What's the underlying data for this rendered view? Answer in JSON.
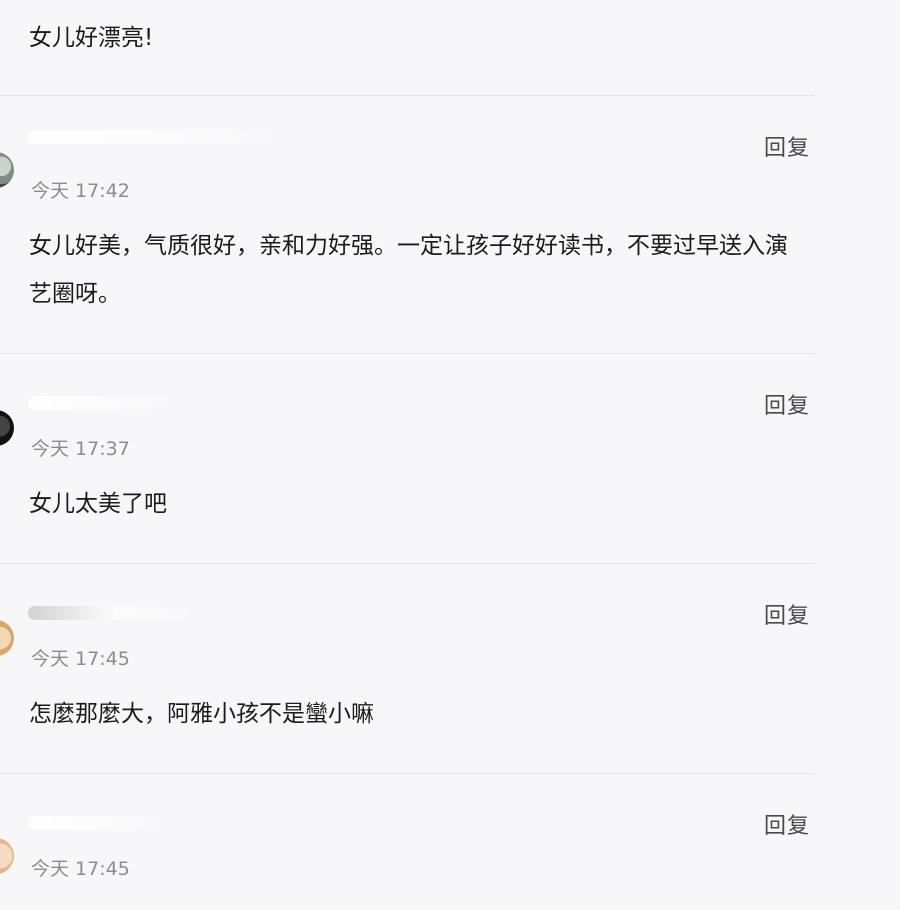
{
  "colors": {
    "background": "#f7f7f9",
    "divider": "#e4e4e8",
    "text": "#1b1b1b",
    "timestamp": "#8c8c8c",
    "reply": "#4a4a4a"
  },
  "comments": [
    {
      "text": "女儿好漂亮!"
    },
    {
      "reply_label": "回复",
      "time": "今天 17:42",
      "text": "女儿好美，气质很好，亲和力好强。一定让孩子好好读书，不要过早送入演艺圈呀。",
      "avatar_icon": "user-avatar-icon"
    },
    {
      "reply_label": "回复",
      "time": "今天 17:37",
      "text": "女儿太美了吧",
      "avatar_icon": "user-avatar-icon"
    },
    {
      "reply_label": "回复",
      "time": "今天 17:45",
      "text": "怎麼那麼大，阿雅小孩不是蠻小嘛",
      "avatar_icon": "user-avatar-icon"
    },
    {
      "reply_label": "回复",
      "time": "今天 17:45",
      "avatar_icon": "user-avatar-icon"
    }
  ]
}
